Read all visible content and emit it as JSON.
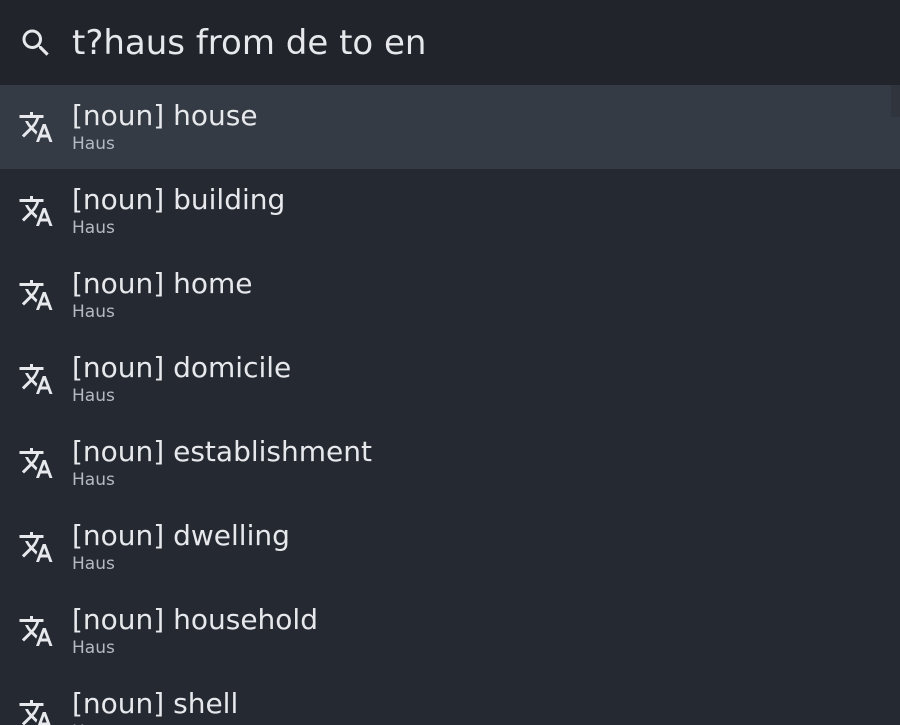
{
  "search": {
    "query": "t?haus from de to en",
    "icon": "search-icon"
  },
  "results": [
    {
      "title": "[noun] house",
      "subtitle": "Haus",
      "icon": "translate-icon",
      "selected": true
    },
    {
      "title": "[noun] building",
      "subtitle": "Haus",
      "icon": "translate-icon",
      "selected": false
    },
    {
      "title": "[noun] home",
      "subtitle": "Haus",
      "icon": "translate-icon",
      "selected": false
    },
    {
      "title": "[noun] domicile",
      "subtitle": "Haus",
      "icon": "translate-icon",
      "selected": false
    },
    {
      "title": "[noun] establishment",
      "subtitle": "Haus",
      "icon": "translate-icon",
      "selected": false
    },
    {
      "title": "[noun] dwelling",
      "subtitle": "Haus",
      "icon": "translate-icon",
      "selected": false
    },
    {
      "title": "[noun] household",
      "subtitle": "Haus",
      "icon": "translate-icon",
      "selected": false
    },
    {
      "title": "[noun] shell",
      "subtitle": "Haus",
      "icon": "translate-icon",
      "selected": false
    }
  ],
  "colors": {
    "background": "#252932",
    "search_bar": "#21252b",
    "selected_row": "#353b45",
    "text_primary": "#e6e8ec",
    "text_secondary": "#b4b9c2"
  }
}
